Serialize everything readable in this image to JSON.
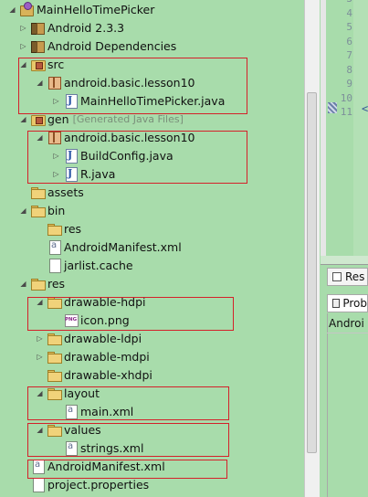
{
  "package_explorer": {
    "rows": [
      {
        "label": "MainHelloTimePicker",
        "arrow": "◢",
        "icon": "project-icon"
      },
      {
        "label": "Android 2.3.3",
        "arrow": "▷",
        "icon": "library-icon"
      },
      {
        "label": "Android Dependencies",
        "arrow": "▷",
        "icon": "library-icon"
      },
      {
        "label": "src",
        "arrow": "◢",
        "icon": "source-folder-icon"
      },
      {
        "label": "android.basic.lesson10",
        "arrow": "◢",
        "icon": "package-icon"
      },
      {
        "label": "MainHelloTimePicker.java",
        "arrow": "▷",
        "icon": "java-file-icon"
      },
      {
        "label": "gen",
        "extra": "[Generated Java Files]",
        "arrow": "◢",
        "icon": "source-folder-icon"
      },
      {
        "label": "android.basic.lesson10",
        "arrow": "◢",
        "icon": "package-icon"
      },
      {
        "label": "BuildConfig.java",
        "arrow": "▷",
        "icon": "java-file-icon"
      },
      {
        "label": "R.java",
        "arrow": "▷",
        "icon": "java-file-icon"
      },
      {
        "label": "assets",
        "arrow": "",
        "icon": "folder-icon"
      },
      {
        "label": "bin",
        "arrow": "◢",
        "icon": "folder-icon"
      },
      {
        "label": "res",
        "arrow": "",
        "icon": "folder-icon"
      },
      {
        "label": "AndroidManifest.xml",
        "arrow": "",
        "icon": "xml-file-icon"
      },
      {
        "label": "jarlist.cache",
        "arrow": "",
        "icon": "file-icon"
      },
      {
        "label": "res",
        "arrow": "◢",
        "icon": "folder-icon"
      },
      {
        "label": "drawable-hdpi",
        "arrow": "◢",
        "icon": "folder-icon"
      },
      {
        "label": "icon.png",
        "arrow": "",
        "icon": "png-file-icon"
      },
      {
        "label": "drawable-ldpi",
        "arrow": "▷",
        "icon": "folder-icon"
      },
      {
        "label": "drawable-mdpi",
        "arrow": "▷",
        "icon": "folder-icon"
      },
      {
        "label": "drawable-xhdpi",
        "arrow": "",
        "icon": "folder-icon"
      },
      {
        "label": "layout",
        "arrow": "◢",
        "icon": "folder-icon"
      },
      {
        "label": "main.xml",
        "arrow": "",
        "icon": "xml-file-icon"
      },
      {
        "label": "values",
        "arrow": "◢",
        "icon": "folder-icon"
      },
      {
        "label": "strings.xml",
        "arrow": "",
        "icon": "xml-file-icon"
      },
      {
        "label": "AndroidManifest.xml",
        "arrow": "",
        "icon": "xml-file-icon"
      },
      {
        "label": "project.properties",
        "arrow": "",
        "icon": "file-icon"
      }
    ]
  },
  "editor": {
    "line_numbers": [
      "3",
      "4",
      "5",
      "6",
      "7",
      "8",
      "9",
      "10",
      "11"
    ],
    "code_fragment": "<"
  },
  "bottom_panel": {
    "tab_resource_label": "Res",
    "tab_problems_label": "Prob",
    "problems_row": "Androi"
  },
  "colors": {
    "highlight_box": "#d4212a",
    "background": "#a8dcab"
  }
}
